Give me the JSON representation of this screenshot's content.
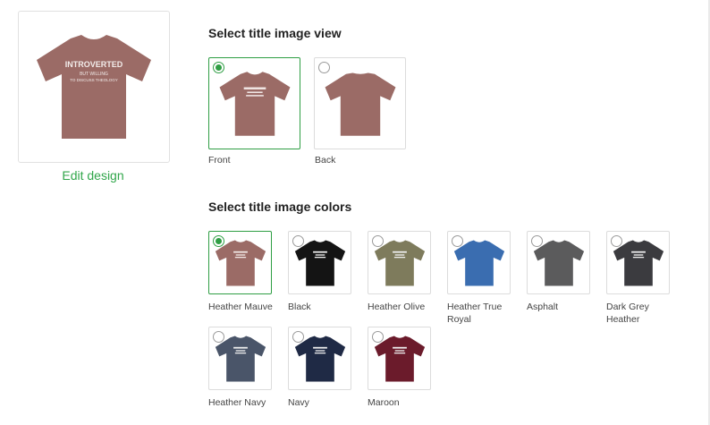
{
  "preview": {
    "shirt_text": [
      "INTROVERTED",
      "BUT WILLING",
      "TO DISCUSS THEOLOGY"
    ],
    "color": "#9b6b66",
    "edit_label": "Edit design"
  },
  "view_section": {
    "title": "Select title image view",
    "options": [
      {
        "label": "Front",
        "selected": true,
        "icon": "tshirt-front-icon"
      },
      {
        "label": "Back",
        "selected": false,
        "icon": "tshirt-back-icon"
      }
    ]
  },
  "color_section": {
    "title": "Select title image colors",
    "colors": [
      {
        "name": "Heather Mauve",
        "hex": "#9b6b66",
        "selected": true
      },
      {
        "name": "Black",
        "hex": "#141414",
        "selected": false
      },
      {
        "name": "Heather Olive",
        "hex": "#7e7b5c",
        "selected": false
      },
      {
        "name": "Heather True Royal",
        "name_lines": [
          "Heather True",
          "Royal"
        ],
        "hex": "#3a6db0",
        "selected": false
      },
      {
        "name": "Asphalt",
        "hex": "#5b5b5c",
        "selected": false
      },
      {
        "name": "Dark Grey Heather",
        "name_lines": [
          "Dark Grey",
          "Heather"
        ],
        "hex": "#3b3b3f",
        "selected": false
      },
      {
        "name": "Heather Navy",
        "hex": "#4a5569",
        "selected": false
      },
      {
        "name": "Navy",
        "hex": "#1f2a45",
        "selected": false
      },
      {
        "name": "Maroon",
        "hex": "#6b1b2b",
        "selected": false
      }
    ]
  },
  "accent_color": "#2f9e44"
}
